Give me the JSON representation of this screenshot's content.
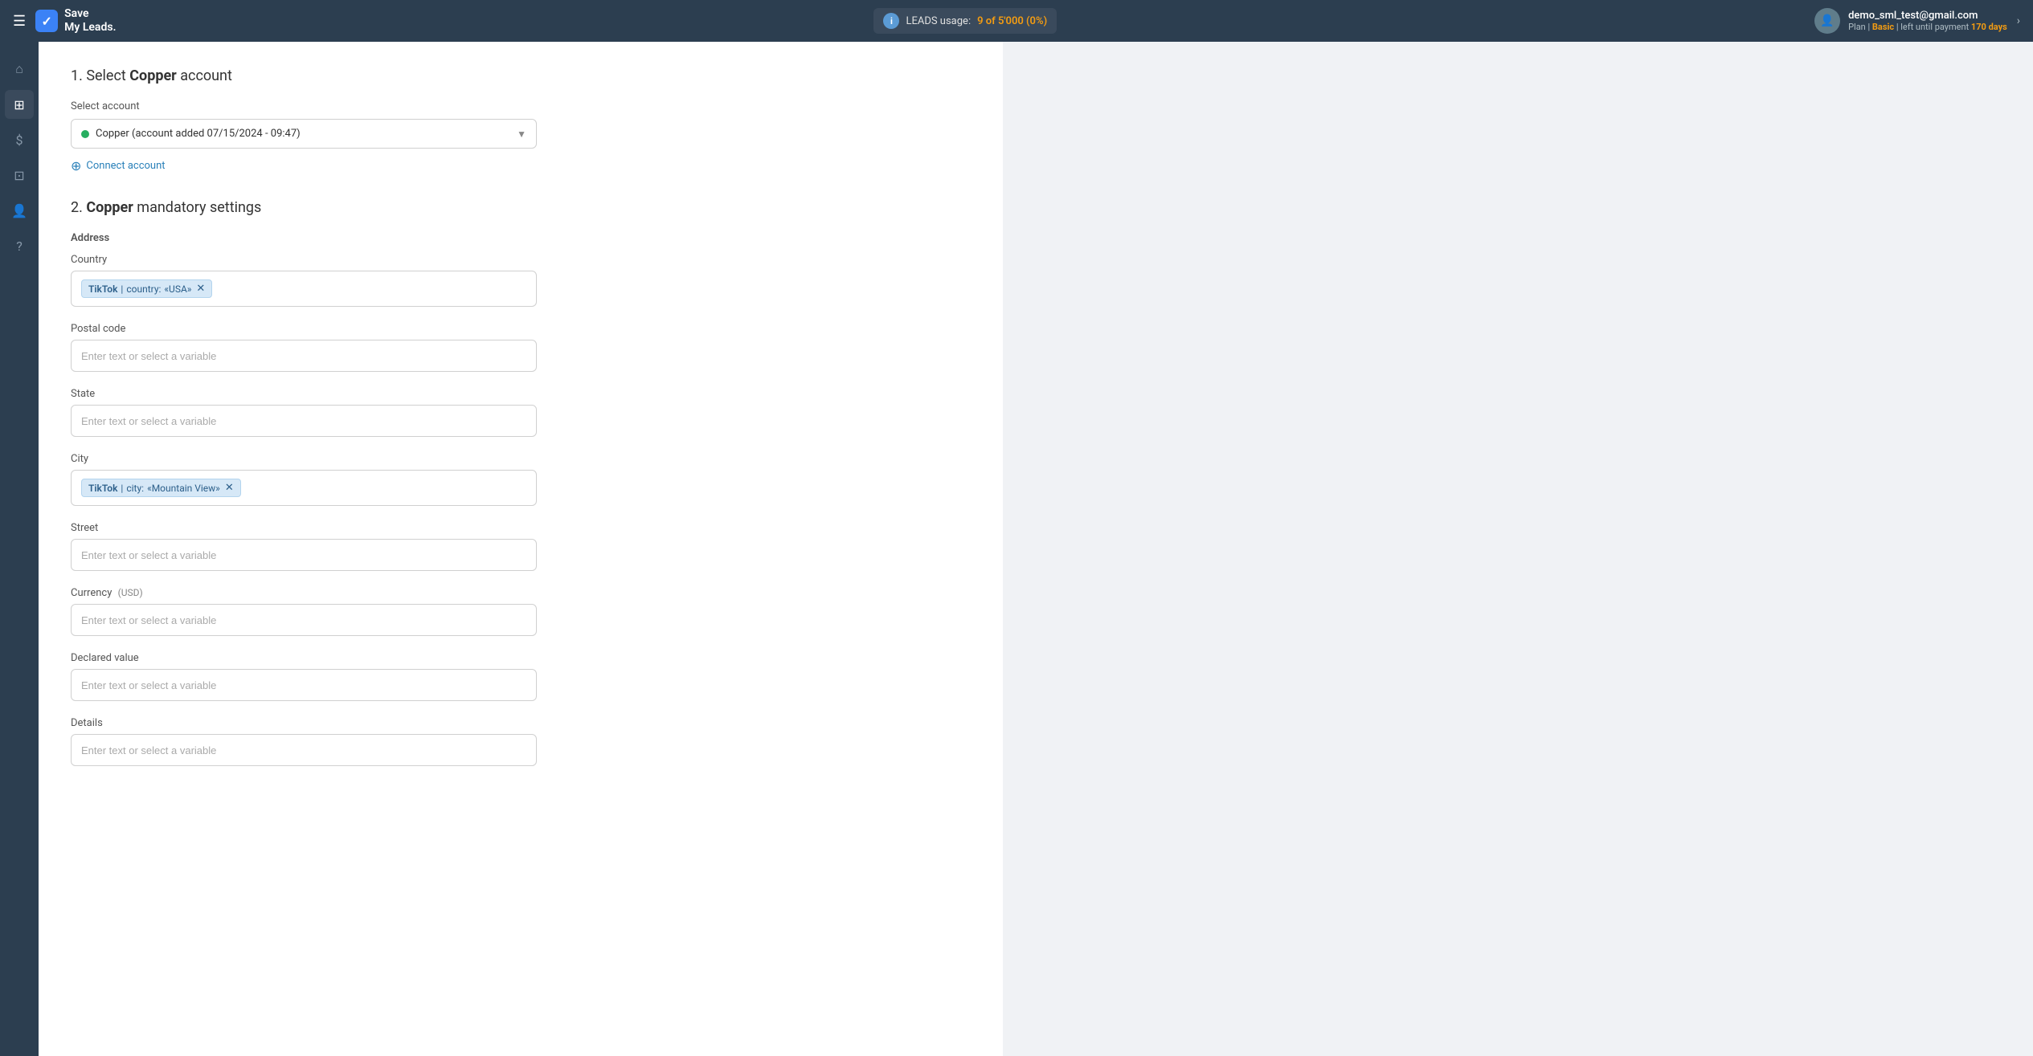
{
  "app": {
    "name": "Save",
    "name2": "My Leads."
  },
  "navbar": {
    "leads_label": "LEADS usage:",
    "leads_count": "9 of 5'000 (0%)",
    "user_email": "demo_sml_test@gmail.com",
    "user_plan_label": "Plan |",
    "user_plan_name": "Basic",
    "user_plan_suffix": "| left until payment",
    "user_plan_days": "170 days"
  },
  "sidebar": {
    "items": [
      {
        "icon": "⌂",
        "label": "home"
      },
      {
        "icon": "⊞",
        "label": "integrations"
      },
      {
        "icon": "$",
        "label": "billing"
      },
      {
        "icon": "⊡",
        "label": "tools"
      },
      {
        "icon": "👤",
        "label": "account"
      },
      {
        "icon": "?",
        "label": "help"
      }
    ]
  },
  "section1": {
    "title_prefix": "1. Select ",
    "title_brand": "Copper",
    "title_suffix": " account",
    "select_label": "Select account",
    "selected_account": "Copper (account added 07/15/2024 - 09:47)",
    "connect_link": "Connect account"
  },
  "section2": {
    "title_prefix": "2. ",
    "title_brand": "Copper",
    "title_suffix": " mandatory settings",
    "subsection_address": "Address",
    "field_country": "Country",
    "field_postal_code": "Postal code",
    "field_state": "State",
    "field_city": "City",
    "field_street": "Street",
    "field_currency": "Currency",
    "field_currency_unit": "(USD)",
    "field_declared_value": "Declared value",
    "field_details": "Details",
    "placeholder": "Enter text or select a variable",
    "country_chip_service": "TikTok",
    "country_chip_field": "country:",
    "country_chip_value": "«USA»",
    "city_chip_service": "TikTok",
    "city_chip_field": "city:",
    "city_chip_value": "«Mountain View»"
  }
}
